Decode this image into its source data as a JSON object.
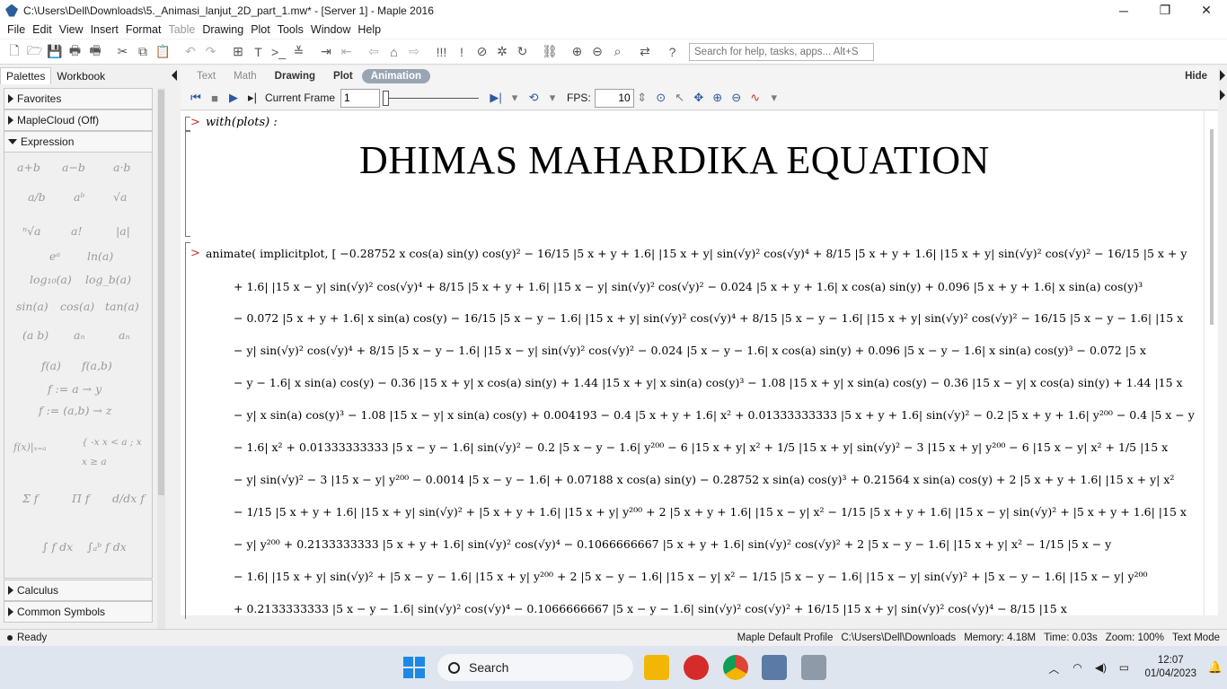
{
  "window": {
    "title": "C:\\Users\\Dell\\Downloads\\5._Animasi_lanjut_2D_part_1.mw* - [Server 1] - Maple 2016",
    "minimize": "─",
    "maximize": "❐",
    "close": "✕"
  },
  "menu": {
    "items": [
      "File",
      "Edit",
      "View",
      "Insert",
      "Format",
      "Table",
      "Drawing",
      "Plot",
      "Tools",
      "Window",
      "Help"
    ]
  },
  "toolbar": {
    "search_placeholder": "Search for help, tasks, apps... Alt+S"
  },
  "left_panel": {
    "tabs": [
      "Palettes",
      "Workbook"
    ],
    "palettes": [
      "Favorites",
      "MapleCloud (Off)",
      "Expression",
      "Calculus",
      "Common Symbols"
    ],
    "expressions": [
      "a+b",
      "a−b",
      "a·b",
      "a/b",
      "aᵇ",
      "√a",
      "ⁿ√a",
      "a!",
      "|a|",
      "eᵃ",
      "ln(a)",
      "log₁₀(a)",
      "log_b(a)",
      "sin(a)",
      "cos(a)",
      "tan(a)",
      "(a b)",
      "aₙ",
      "aₙ",
      "f(a)",
      "f(a,b)",
      "f := a → y",
      "f := (a,b) → z",
      "f(x)|ₓ₌ₐ",
      "{ -x  x < a ;  x  x ≥ a",
      "Σ f",
      "Π f",
      "d/dx f",
      "∫ f dx",
      "∫ₐᵇ f dx"
    ]
  },
  "context_bar": {
    "tabs": [
      "Text",
      "Math",
      "Drawing",
      "Plot",
      "Animation"
    ],
    "active": "Animation",
    "hide": "Hide"
  },
  "animation_bar": {
    "current_frame_label": "Current Frame",
    "current_frame": "1",
    "fps_label": "FPS:",
    "fps": "10"
  },
  "worksheet": {
    "cmd1": "with(plots) :",
    "heading": "DHIMAS MAHARDIKA EQUATION",
    "cmd2_prefix": "animate( implicitplot, [ ",
    "math_lines": [
      "animate( implicitplot, [ −0.28752 x cos(a) sin(y) cos(y)² − 16/15 |5 x + y + 1.6| |15 x + y| sin(√y)² cos(√y)⁴ + 8/15 |5 x + y + 1.6| |15 x + y| sin(√y)² cos(√y)² − 16/15 |5 x + y",
      "+ 1.6| |15 x − y| sin(√y)² cos(√y)⁴ + 8/15 |5 x + y + 1.6| |15 x − y| sin(√y)² cos(√y)² − 0.024 |5 x + y + 1.6| x cos(a) sin(y) + 0.096 |5 x + y + 1.6| x sin(a) cos(y)³",
      "− 0.072 |5 x + y + 1.6| x sin(a) cos(y) − 16/15 |5 x − y − 1.6| |15 x + y| sin(√y)² cos(√y)⁴ + 8/15 |5 x − y − 1.6| |15 x + y| sin(√y)² cos(√y)² − 16/15 |5 x − y − 1.6| |15 x",
      "− y| sin(√y)² cos(√y)⁴ + 8/15 |5 x − y − 1.6| |15 x − y| sin(√y)² cos(√y)² − 0.024 |5 x − y − 1.6| x cos(a) sin(y) + 0.096 |5 x − y − 1.6| x sin(a) cos(y)³ − 0.072 |5 x",
      "− y − 1.6| x sin(a) cos(y) − 0.36 |15 x + y| x cos(a) sin(y) + 1.44 |15 x + y| x sin(a) cos(y)³ − 1.08 |15 x + y| x sin(a) cos(y) − 0.36 |15 x − y| x cos(a) sin(y) + 1.44 |15 x",
      "− y| x sin(a) cos(y)³ − 1.08 |15 x − y| x sin(a) cos(y) + 0.004193 − 0.4 |5 x + y + 1.6| x² + 0.01333333333 |5 x + y + 1.6| sin(√y)² − 0.2 |5 x + y + 1.6| y²⁰⁰ − 0.4 |5 x − y",
      "− 1.6| x² + 0.01333333333 |5 x − y − 1.6| sin(√y)² − 0.2 |5 x − y − 1.6| y²⁰⁰ − 6 |15 x + y| x² + 1/5 |15 x + y| sin(√y)² − 3 |15 x + y| y²⁰⁰ − 6 |15 x − y| x² + 1/5 |15 x",
      "− y| sin(√y)² − 3 |15 x − y| y²⁰⁰ − 0.0014 |5 x − y − 1.6| + 0.07188 x cos(a) sin(y) − 0.28752 x sin(a) cos(y)³ + 0.21564 x sin(a) cos(y) + 2 |5 x + y + 1.6| |15 x + y| x²",
      "− 1/15 |5 x + y + 1.6| |15 x + y| sin(√y)² + |5 x + y + 1.6| |15 x + y| y²⁰⁰ + 2 |5 x + y + 1.6| |15 x − y| x² − 1/15 |5 x + y + 1.6| |15 x − y| sin(√y)² + |5 x + y + 1.6| |15 x",
      "− y| y²⁰⁰ + 0.2133333333 |5 x + y + 1.6| sin(√y)² cos(√y)⁴ − 0.1066666667 |5 x + y + 1.6| sin(√y)² cos(√y)² + 2 |5 x − y − 1.6| |15 x + y| x² − 1/15 |5 x − y",
      "− 1.6| |15 x + y| sin(√y)² + |5 x − y − 1.6| |15 x + y| y²⁰⁰ + 2 |5 x − y − 1.6| |15 x − y| x² − 1/15 |5 x − y − 1.6| |15 x − y| sin(√y)² + |5 x − y − 1.6| |15 x − y| y²⁰⁰",
      "+ 0.2133333333 |5 x − y − 1.6| sin(√y)² cos(√y)⁴ − 0.1066666667 |5 x − y − 1.6| sin(√y)² cos(√y)² + 16/15 |15 x + y| sin(√y)² cos(√y)⁴ − 8/15 |15 x"
    ]
  },
  "status_bar": {
    "state": "Ready",
    "profile": "Maple Default Profile",
    "path": "C:\\Users\\Dell\\Downloads",
    "memory": "Memory: 4.18M",
    "time": "Time: 0.03s",
    "zoom": "Zoom: 100%",
    "mode": "Text Mode"
  },
  "taskbar": {
    "search": "Search",
    "time": "12:07",
    "date": "01/04/2023"
  },
  "colors": {
    "accent": "#2c5aa0",
    "prompt": "#c0392b",
    "active_tab": "#9aa5b4"
  }
}
